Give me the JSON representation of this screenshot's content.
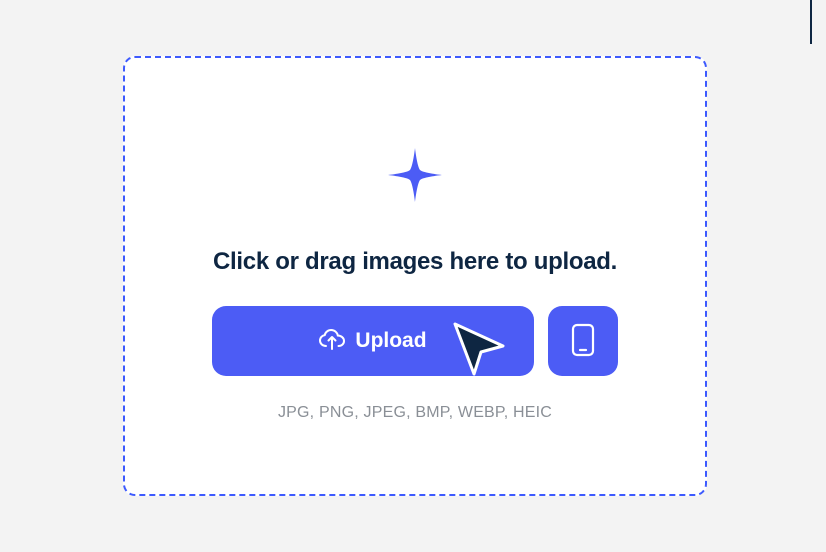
{
  "dropzone": {
    "heading": "Click or drag images here to upload.",
    "upload_button_label": "Upload",
    "supported_formats": "JPG, PNG, JPEG, BMP, WEBP, HEIC"
  },
  "colors": {
    "accent": "#4c5cf5",
    "dark": "#0e2642",
    "muted": "#8a8f96",
    "bg": "#f3f3f3"
  }
}
